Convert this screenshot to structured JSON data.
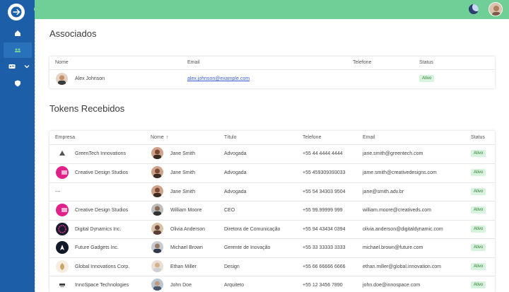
{
  "associados": {
    "title": "Associados",
    "headers": {
      "nome": "Nome",
      "email": "Email",
      "telefone": "Telefone",
      "status": "Status"
    },
    "row": {
      "nome": "Alex Johnson",
      "email": "alex.johnson@example.com",
      "telefone": "",
      "status": "Ativo"
    }
  },
  "tokens": {
    "title": "Tokens Recebidos",
    "headers": {
      "empresa": "Empresa",
      "nome": "Nome",
      "sort": "↑",
      "titulo": "Título",
      "telefone": "Telefone",
      "email": "Email",
      "status": "Status"
    },
    "rows": [
      {
        "empresa": "GreenTech Innovations",
        "nome": "Jane Smith",
        "titulo": "Advogada",
        "telefone": "+55 44 4444 4444",
        "email": "jane.smith@greentech.com",
        "status": "Ativo"
      },
      {
        "empresa": "Creative Design Studios",
        "nome": "Jane Smith",
        "titulo": "Advogada",
        "telefone": "+55 459309393033",
        "email": "jame.smith@creativedesigns.com",
        "status": "Ativo"
      },
      {
        "empresa": "---",
        "nome": "Jane Smith",
        "titulo": "Advogada",
        "telefone": "+55 54 34303 9504",
        "email": "jane@smith.adv.br",
        "status": "Ativo"
      },
      {
        "empresa": "Creative Design Studios",
        "nome": "William Moore",
        "titulo": "CEO",
        "telefone": "+55 99.99999 999",
        "email": "william.moore@creativeds.com",
        "status": "Ativo"
      },
      {
        "empresa": "Digital Dynamics Inc.",
        "nome": "Olivia Anderson",
        "titulo": "Diretora de Comunicação",
        "telefone": "+55 94 43434 0394",
        "email": "olivia.anderson@digitaldynamic.com",
        "status": "Ativo"
      },
      {
        "empresa": "Future Gadgets Inc.",
        "nome": "Michael Brown",
        "titulo": "Gerente de Inovação",
        "telefone": "+55 33 33333 3333",
        "email": "michael.brown@future.com",
        "status": "Ativo"
      },
      {
        "empresa": "Global Innovations Corp.",
        "nome": "Ethan Miller",
        "titulo": "Design",
        "telefone": "+55 66 66666 6666",
        "email": "ethan.miller@global.innovation.com",
        "status": "Ativo"
      },
      {
        "empresa": "InnoSpace Technologies",
        "nome": "John Doe",
        "titulo": "Arquiteto",
        "telefone": "+55 12 3456 7890",
        "email": "john.doe@innospace.com",
        "status": "Ativo"
      }
    ]
  },
  "colors": {
    "sidebar": "#1c5fa8",
    "topbar": "#6fcf97",
    "badge_bg": "#d7f2dd",
    "badge_text": "#2e7d32",
    "link": "#3b5bdb"
  },
  "icons": [
    "logo-icon",
    "gear-icon",
    "home-icon",
    "users-icon",
    "id-card-icon",
    "chevron-down-icon",
    "shield-icon",
    "moon-icon"
  ]
}
